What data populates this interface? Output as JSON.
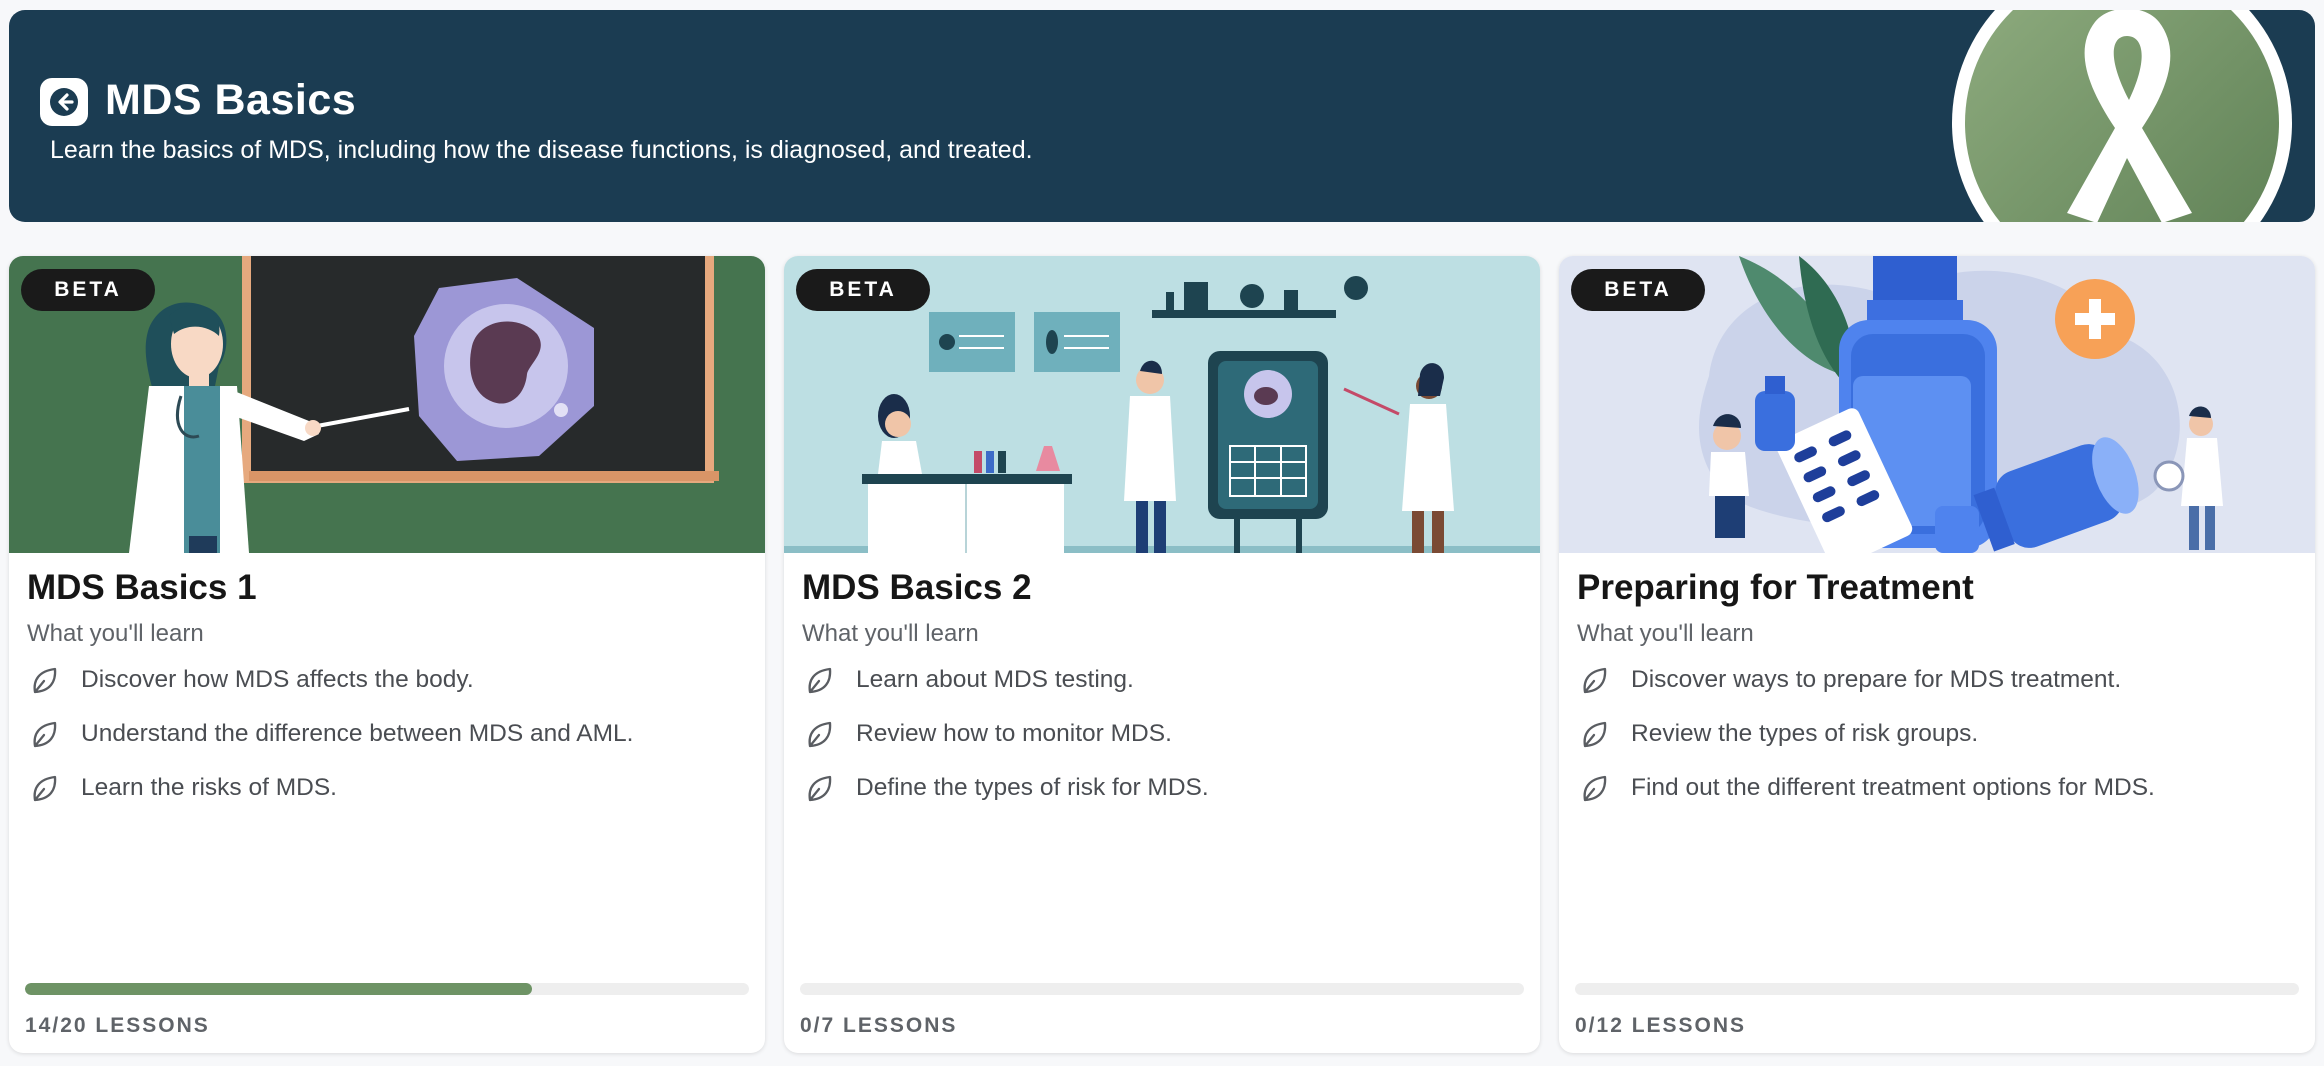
{
  "header": {
    "title": "MDS Basics",
    "subtitle": "Learn the basics of MDS, including how the disease functions, is diagnosed, and treated.",
    "back_icon": "arrow-left-icon",
    "emblem_icon": "awareness-ribbon-icon"
  },
  "colors": {
    "header_bg": "#1b3c52",
    "progress_fill": "#6e9365",
    "progress_track": "#eeeeee",
    "badge_bg": "#1a1a1a"
  },
  "cards": [
    {
      "badge": "BETA",
      "title": "MDS Basics 1",
      "subtitle": "What you'll learn",
      "items": [
        "Discover how MDS affects the body.",
        "Understand the difference between MDS and AML.",
        "Learn the risks of MDS."
      ],
      "progress": 0.7,
      "lessons": "14/20 LESSONS",
      "illustration": "teacher-at-chalkboard-illustration"
    },
    {
      "badge": "BETA",
      "title": "MDS Basics 2",
      "subtitle": "What you'll learn",
      "items": [
        "Learn about MDS testing.",
        "Review how to monitor MDS.",
        "Define the types of risk for MDS."
      ],
      "progress": 0,
      "lessons": "0/7 LESSONS",
      "illustration": "laboratory-scientists-illustration"
    },
    {
      "badge": "BETA",
      "title": "Preparing for Treatment",
      "subtitle": "What you'll learn",
      "items": [
        "Discover ways to prepare for MDS treatment.",
        "Review the types of risk groups.",
        "Find out the different treatment options for MDS."
      ],
      "progress": 0,
      "lessons": "0/12 LESSONS",
      "illustration": "medication-bottles-illustration"
    }
  ]
}
